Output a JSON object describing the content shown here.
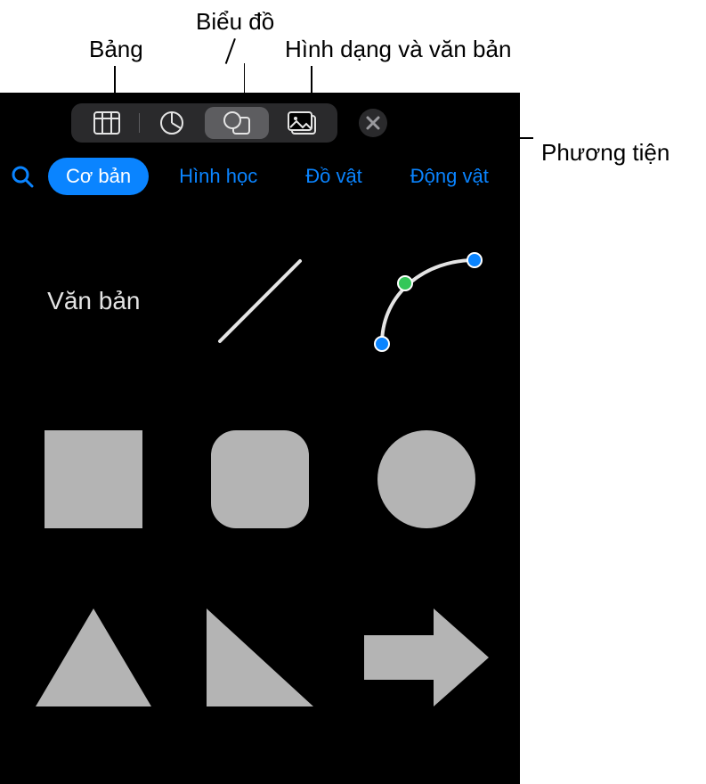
{
  "callouts": {
    "table": "Bảng",
    "chart": "Biểu đồ",
    "shapes": "Hình dạng và văn bản",
    "media": "Phương tiện"
  },
  "categories": {
    "basic": "Cơ bản",
    "geometry": "Hình học",
    "objects": "Đồ vật",
    "animals": "Động vật"
  },
  "shapes": {
    "text_label": "Văn bản"
  },
  "colors": {
    "accent": "#0a84ff",
    "panel_bg": "#000000",
    "shape_fill": "#b4b4b4"
  }
}
